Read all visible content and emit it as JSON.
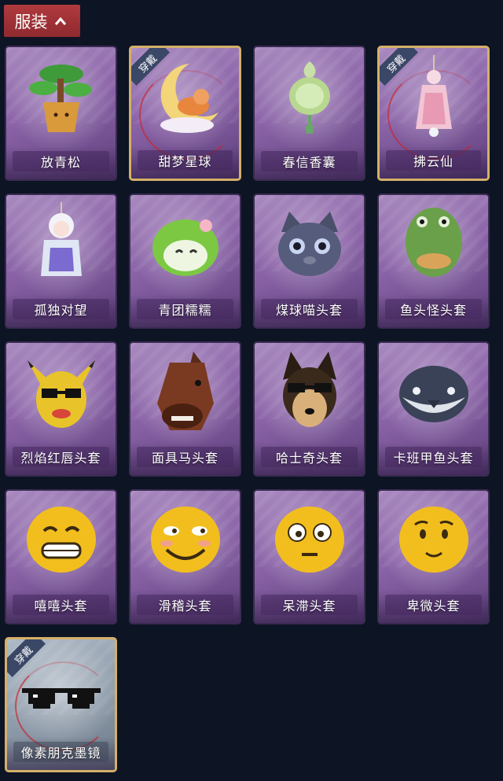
{
  "header": {
    "title": "服装"
  },
  "badge_text": "穿戴",
  "items": [
    {
      "label": "放青松",
      "equipped": false,
      "icon": "bonsai-pine-icon"
    },
    {
      "label": "甜梦星球",
      "equipped": true,
      "icon": "moon-cat-icon"
    },
    {
      "label": "春信香囊",
      "equipped": false,
      "icon": "sachet-icon"
    },
    {
      "label": "拂云仙",
      "equipped": true,
      "icon": "fairy-charm-icon"
    },
    {
      "label": "孤独对望",
      "equipped": false,
      "icon": "doll-charm-icon"
    },
    {
      "label": "青团糯糯",
      "equipped": false,
      "icon": "green-dumpling-icon"
    },
    {
      "label": "煤球喵头套",
      "equipped": false,
      "icon": "cat-head-icon"
    },
    {
      "label": "鱼头怪头套",
      "equipped": false,
      "icon": "fish-head-icon"
    },
    {
      "label": "烈焰红唇头套",
      "equipped": false,
      "icon": "yellow-mouse-head-icon"
    },
    {
      "label": "面具马头套",
      "equipped": false,
      "icon": "horse-head-icon"
    },
    {
      "label": "哈士奇头套",
      "equipped": false,
      "icon": "dog-head-icon"
    },
    {
      "label": "卡班甲鱼头套",
      "equipped": false,
      "icon": "whale-head-icon"
    },
    {
      "label": "嘻嘻头套",
      "equipped": false,
      "icon": "grin-emoji-icon"
    },
    {
      "label": "滑稽头套",
      "equipped": false,
      "icon": "smirk-emoji-icon"
    },
    {
      "label": "呆滞头套",
      "equipped": false,
      "icon": "dazed-emoji-icon"
    },
    {
      "label": "卑微头套",
      "equipped": false,
      "icon": "humble-emoji-icon"
    },
    {
      "label": "像素朋克墨镜",
      "equipped": true,
      "icon": "pixel-sunglasses-icon"
    }
  ]
}
